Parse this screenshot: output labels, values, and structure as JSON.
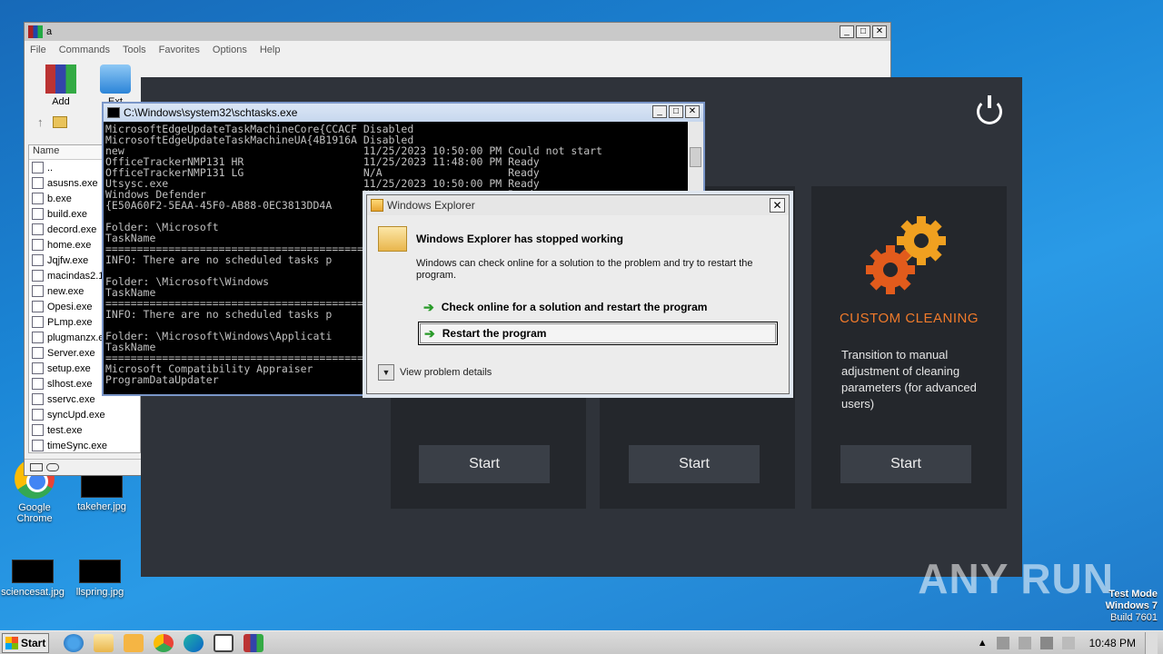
{
  "desktop": {
    "icons": [
      {
        "label": "Google Chrome"
      },
      {
        "label": "takeher.jpg"
      },
      {
        "label": "sciencesat.jpg"
      },
      {
        "label": "llspring.jpg"
      }
    ],
    "watermark": "ANY RUN",
    "test_mode": {
      "line1": "Test Mode",
      "line2": "Windows 7",
      "line3": "Build 7601"
    }
  },
  "winrar": {
    "title": "a",
    "menu": [
      "File",
      "Commands",
      "Tools",
      "Favorites",
      "Options",
      "Help"
    ],
    "toolbar": [
      {
        "label": "Add"
      },
      {
        "label": "Ext"
      }
    ],
    "column_header": "Name",
    "files": [
      "..",
      "asusns.exe",
      "b.exe",
      "build.exe",
      "decord.exe",
      "home.exe",
      "Jqjfw.exe",
      "macindas2.1",
      "new.exe",
      "Opesi.exe",
      "PLmp.exe",
      "plugmanzx.e",
      "Server.exe",
      "setup.exe",
      "slhost.exe",
      "sservc.exe",
      "syncUpd.exe",
      "test.exe",
      "timeSync.exe"
    ]
  },
  "cleaner": {
    "cards": [
      {
        "title": "",
        "description": "",
        "start_label": "Start"
      },
      {
        "title": "",
        "description": "",
        "start_label": "Start"
      },
      {
        "title": "CUSTOM CLEANING",
        "description": "Transition to manual adjustment of cleaning parameters (for advanced users)",
        "start_label": "Start"
      }
    ]
  },
  "cmd": {
    "title": "C:\\Windows\\system32\\schtasks.exe",
    "text": "MicrosoftEdgeUpdateTaskMachineCore{CCACF Disabled\nMicrosoftEdgeUpdateTaskMachineUA{4B1916A Disabled\nnew                                      11/25/2023 10:50:00 PM Could not start\nOfficeTrackerNMP131 HR                   11/25/2023 11:48:00 PM Ready\nOfficeTrackerNMP131 LG                   N/A                    Ready\nUtsysc.exe                               11/25/2023 10:50:00 PM Ready\nWindows Defender                         N/A                    Ready\n{E50A60F2-5EAA-45F0-AB88-0EC3813DD4A\n\nFolder: \\Microsoft\nTaskName\n=========================================\nINFO: There are no scheduled tasks p\n\nFolder: \\Microsoft\\Windows\nTaskName\n=========================================\nINFO: There are no scheduled tasks p\n\nFolder: \\Microsoft\\Windows\\Applicati\nTaskName\n=========================================\nMicrosoft Compatibility Appraiser\nProgramDataUpdater"
  },
  "dialog": {
    "title": "Windows Explorer",
    "heading": "Windows Explorer has stopped working",
    "message": "Windows can check online for a solution to the problem and try to restart the program.",
    "option1": "Check online for a solution and restart the program",
    "option2": "Restart the program",
    "details": "View problem details"
  },
  "taskbar": {
    "start_label": "Start",
    "clock": "10:48 PM"
  }
}
